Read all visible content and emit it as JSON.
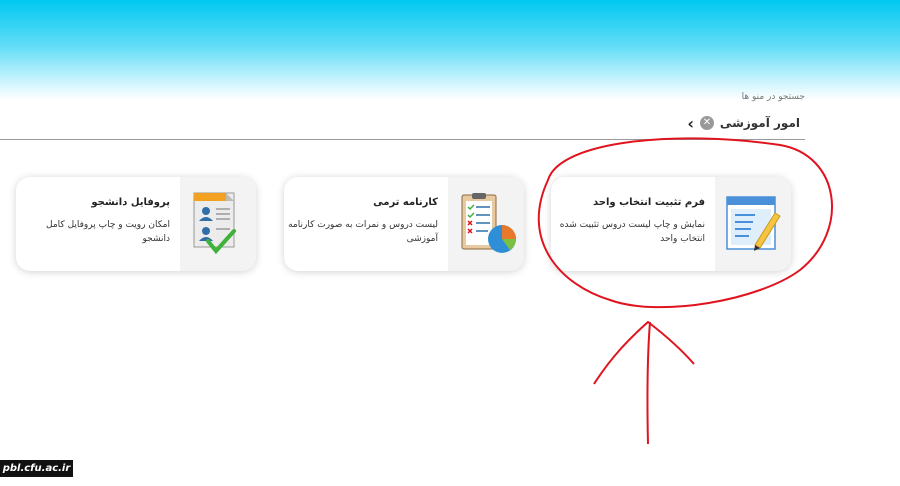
{
  "header": {
    "search_hint": "جستجو در منو ها"
  },
  "breadcrumb": {
    "label": "امور آموزشی"
  },
  "cards": [
    {
      "title": "پروفایل دانشجو",
      "desc": "امکان رویت و چاپ پروفایل کامل دانشجو",
      "icon": "student-profile-icon"
    },
    {
      "title": "کارنامه ترمی",
      "desc": "لیست دروس و نمرات به صورت کارنامه آموزشی",
      "icon": "report-card-chart-icon"
    },
    {
      "title": "فرم تثبیت انتخاب واحد",
      "desc": "نمایش و چاپ لیست دروس تثبیت شده انتخاب واحد",
      "icon": "form-edit-icon"
    }
  ],
  "watermark": "pbl.cfu.ac.ir",
  "colors": {
    "header_gradient_top": "#00c8f0",
    "annotation": "#e0141e"
  }
}
